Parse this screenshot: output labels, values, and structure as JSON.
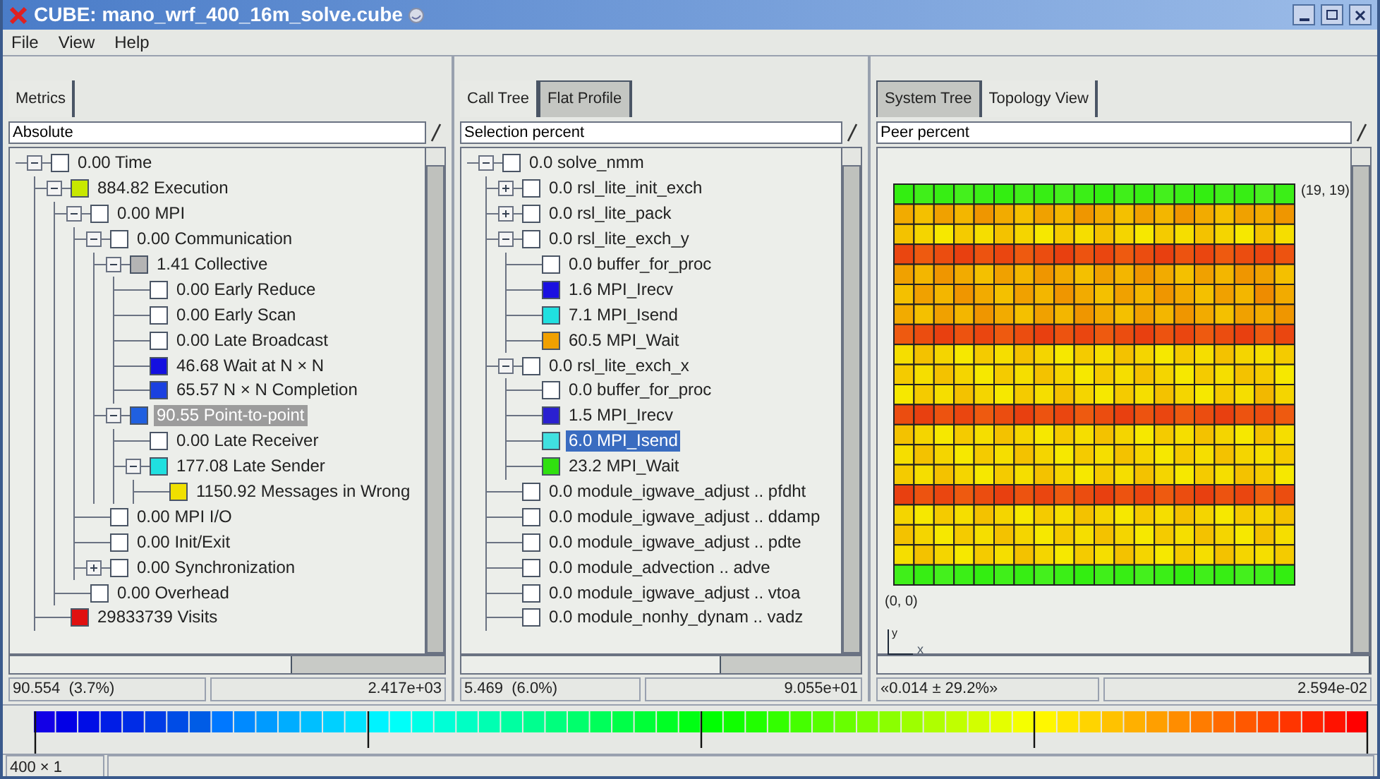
{
  "window": {
    "title": "CUBE: mano_wrf_400_16m_solve.cube"
  },
  "menu": [
    "File",
    "View",
    "Help"
  ],
  "metrics_panel": {
    "tabs": [
      {
        "label": "Metrics",
        "selected": true
      }
    ],
    "mode": "Absolute",
    "tree": [
      {
        "label": "0.00 Time",
        "color": "#ffffff",
        "selected": false,
        "expanded": true,
        "children": [
          {
            "label": "884.82 Execution",
            "color": "#c8e800",
            "selected": false,
            "expanded": true,
            "children": [
              {
                "label": "0.00 MPI",
                "color": "#ffffff",
                "selected": false,
                "expanded": true,
                "children": [
                  {
                    "label": "0.00 Communication",
                    "color": "#ffffff",
                    "selected": false,
                    "expanded": true,
                    "children": [
                      {
                        "label": "1.41 Collective",
                        "color": "#b4b4b4",
                        "selected": false,
                        "expanded": true,
                        "children": [
                          {
                            "label": "0.00 Early Reduce",
                            "color": "#ffffff",
                            "selected": false
                          },
                          {
                            "label": "0.00 Early Scan",
                            "color": "#ffffff",
                            "selected": false
                          },
                          {
                            "label": "0.00 Late Broadcast",
                            "color": "#ffffff",
                            "selected": false
                          },
                          {
                            "label": "46.68 Wait at N × N",
                            "color": "#1410e0",
                            "selected": false
                          },
                          {
                            "label": "65.57 N × N Completion",
                            "color": "#1a40e0",
                            "selected": false
                          }
                        ]
                      },
                      {
                        "label": "90.55 Point-to-point",
                        "color": "#2060e0",
                        "selected": true,
                        "expanded": true,
                        "children": [
                          {
                            "label": "0.00 Late Receiver",
                            "color": "#ffffff",
                            "selected": false
                          },
                          {
                            "label": "177.08 Late Sender",
                            "color": "#20e0e0",
                            "selected": false,
                            "expanded": true,
                            "children": [
                              {
                                "label": "1150.92 Messages in Wrong",
                                "color": "#f0e000",
                                "selected": false
                              }
                            ]
                          }
                        ]
                      }
                    ]
                  },
                  {
                    "label": "0.00 MPI I/O",
                    "color": "#ffffff",
                    "selected": false
                  },
                  {
                    "label": "0.00 Init/Exit",
                    "color": "#ffffff",
                    "selected": false
                  },
                  {
                    "label": "0.00 Synchronization",
                    "color": "#ffffff",
                    "selected": false,
                    "expanded": false
                  }
                ]
              },
              {
                "label": "0.00 Overhead",
                "color": "#ffffff",
                "selected": false
              }
            ]
          },
          {
            "label": "29833739 Visits",
            "color": "#e01010",
            "selected": false
          }
        ]
      }
    ],
    "status": [
      "90.554  (3.7%)",
      "2.417e+03"
    ]
  },
  "calltree_panel": {
    "tabs": [
      {
        "label": "Call Tree",
        "selected": true
      },
      {
        "label": "Flat Profile",
        "selected": false
      }
    ],
    "mode": "Selection percent",
    "tree": [
      {
        "label": "0.0 solve_nmm",
        "color": "#ffffff",
        "selected": false,
        "expanded": true,
        "children": [
          {
            "label": "0.0 rsl_lite_init_exch",
            "color": "#ffffff",
            "selected": false,
            "expanded": false
          },
          {
            "label": "0.0 rsl_lite_pack",
            "color": "#ffffff",
            "selected": false,
            "expanded": false
          },
          {
            "label": "0.0 rsl_lite_exch_y",
            "color": "#ffffff",
            "selected": false,
            "expanded": true,
            "children": [
              {
                "label": "0.0 buffer_for_proc",
                "color": "#ffffff",
                "selected": false
              },
              {
                "label": "1.6 MPI_Irecv",
                "color": "#1a10e0",
                "selected": false
              },
              {
                "label": "7.1 MPI_Isend",
                "color": "#20e0e0",
                "selected": false
              },
              {
                "label": "60.5 MPI_Wait",
                "color": "#f0a000",
                "selected": false
              }
            ]
          },
          {
            "label": "0.0 rsl_lite_exch_x",
            "color": "#ffffff",
            "selected": false,
            "expanded": true,
            "children": [
              {
                "label": "0.0 buffer_for_proc",
                "color": "#ffffff",
                "selected": false
              },
              {
                "label": "1.5 MPI_Irecv",
                "color": "#2a20d0",
                "selected": false
              },
              {
                "label": "6.0 MPI_Isend",
                "color": "#40e0e0",
                "selected": true
              },
              {
                "label": "23.2 MPI_Wait",
                "color": "#30e010",
                "selected": false
              }
            ]
          },
          {
            "label": "0.0 module_igwave_adjust .. pfdht",
            "color": "#ffffff",
            "selected": false
          },
          {
            "label": "0.0 module_igwave_adjust .. ddamp",
            "color": "#ffffff",
            "selected": false
          },
          {
            "label": "0.0 module_igwave_adjust .. pdte",
            "color": "#ffffff",
            "selected": false
          },
          {
            "label": "0.0 module_advection .. adve",
            "color": "#ffffff",
            "selected": false
          },
          {
            "label": "0.0 module_igwave_adjust .. vtoa",
            "color": "#ffffff",
            "selected": false
          },
          {
            "label": "0.0 module_nonhy_dynam .. vadz",
            "color": "#ffffff",
            "selected": false
          }
        ]
      }
    ],
    "status": [
      "5.469  (6.0%)",
      "9.055e+01"
    ]
  },
  "system_panel": {
    "tabs": [
      {
        "label": "System Tree",
        "selected": false
      },
      {
        "label": "Topology View",
        "selected": true
      }
    ],
    "mode": "Peer percent",
    "topology": {
      "max_corner": "(19, 19)",
      "min_corner": "(0, 0)",
      "axis_y": "y",
      "axis_x": "x"
    },
    "status": [
      "«0.014 ± 29.2%»",
      "2.594e-02"
    ]
  },
  "bottom_status": [
    "400 × 1"
  ]
}
